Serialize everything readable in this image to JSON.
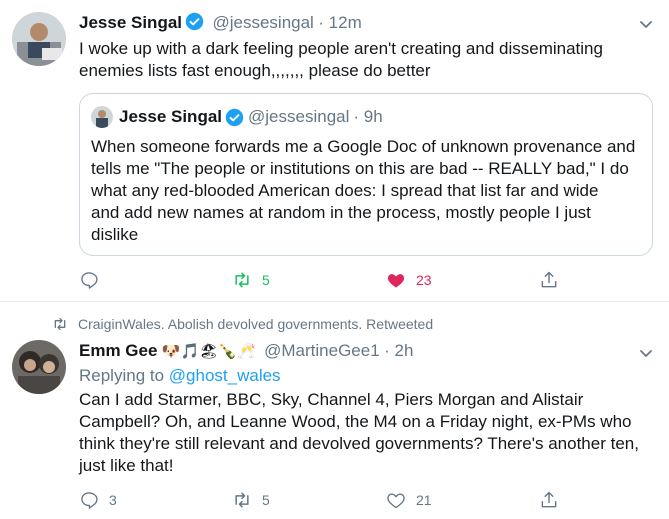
{
  "tweet1": {
    "name": "Jesse Singal",
    "handle": "@jessesingal",
    "time": "· 12m",
    "text_lines": [
      "I woke up with a dark feeling people aren't creating and disseminating",
      "enemies lists fast enough,,,,,,, please do better"
    ],
    "quote": {
      "name": "Jesse Singal",
      "handle": "@jessesingal",
      "time": "· 9h",
      "text_lines": [
        "When someone forwards me a Google Doc of unknown provenance and",
        "tells me \"The people or institutions on this are bad -- REALLY bad,\" I do",
        "what any red-blooded American does: I spread that list far and wide",
        "and add new names at random in the process, mostly people I just",
        "dislike"
      ]
    },
    "actions": {
      "retweets": "5",
      "likes": "23"
    }
  },
  "tweet2": {
    "retweeted_by": "CraiginWales. Abolish devolved governments. Retweeted",
    "name": "Emm Gee",
    "emojis": [
      "🐶",
      "🎵",
      "🏖",
      "🍾",
      "🥂"
    ],
    "handle": "@MartineGee1",
    "time": "· 2h",
    "replying_label": "Replying to",
    "replying_to": "@ghost_wales",
    "text_lines": [
      "Can I add Starmer, BBC, Sky, Channel 4, Piers Morgan and Alistair",
      "Campbell? Oh, and Leanne Wood, the M4 on a Friday night, ex-PMs who",
      "think they're still relevant and devolved governments? There's another ten,",
      "just like that!"
    ],
    "actions": {
      "replies": "3",
      "retweets": "5",
      "likes": "21"
    }
  },
  "colors": {
    "verified": "#1da1f2",
    "retweet_active": "#17bf63",
    "like_active": "#e0245e",
    "secondary_text": "#657786",
    "link": "#1da1f2"
  },
  "icons": [
    "reply-icon",
    "retweet-icon",
    "like-icon",
    "share-icon",
    "caret-down-icon",
    "verified-badge-icon"
  ]
}
